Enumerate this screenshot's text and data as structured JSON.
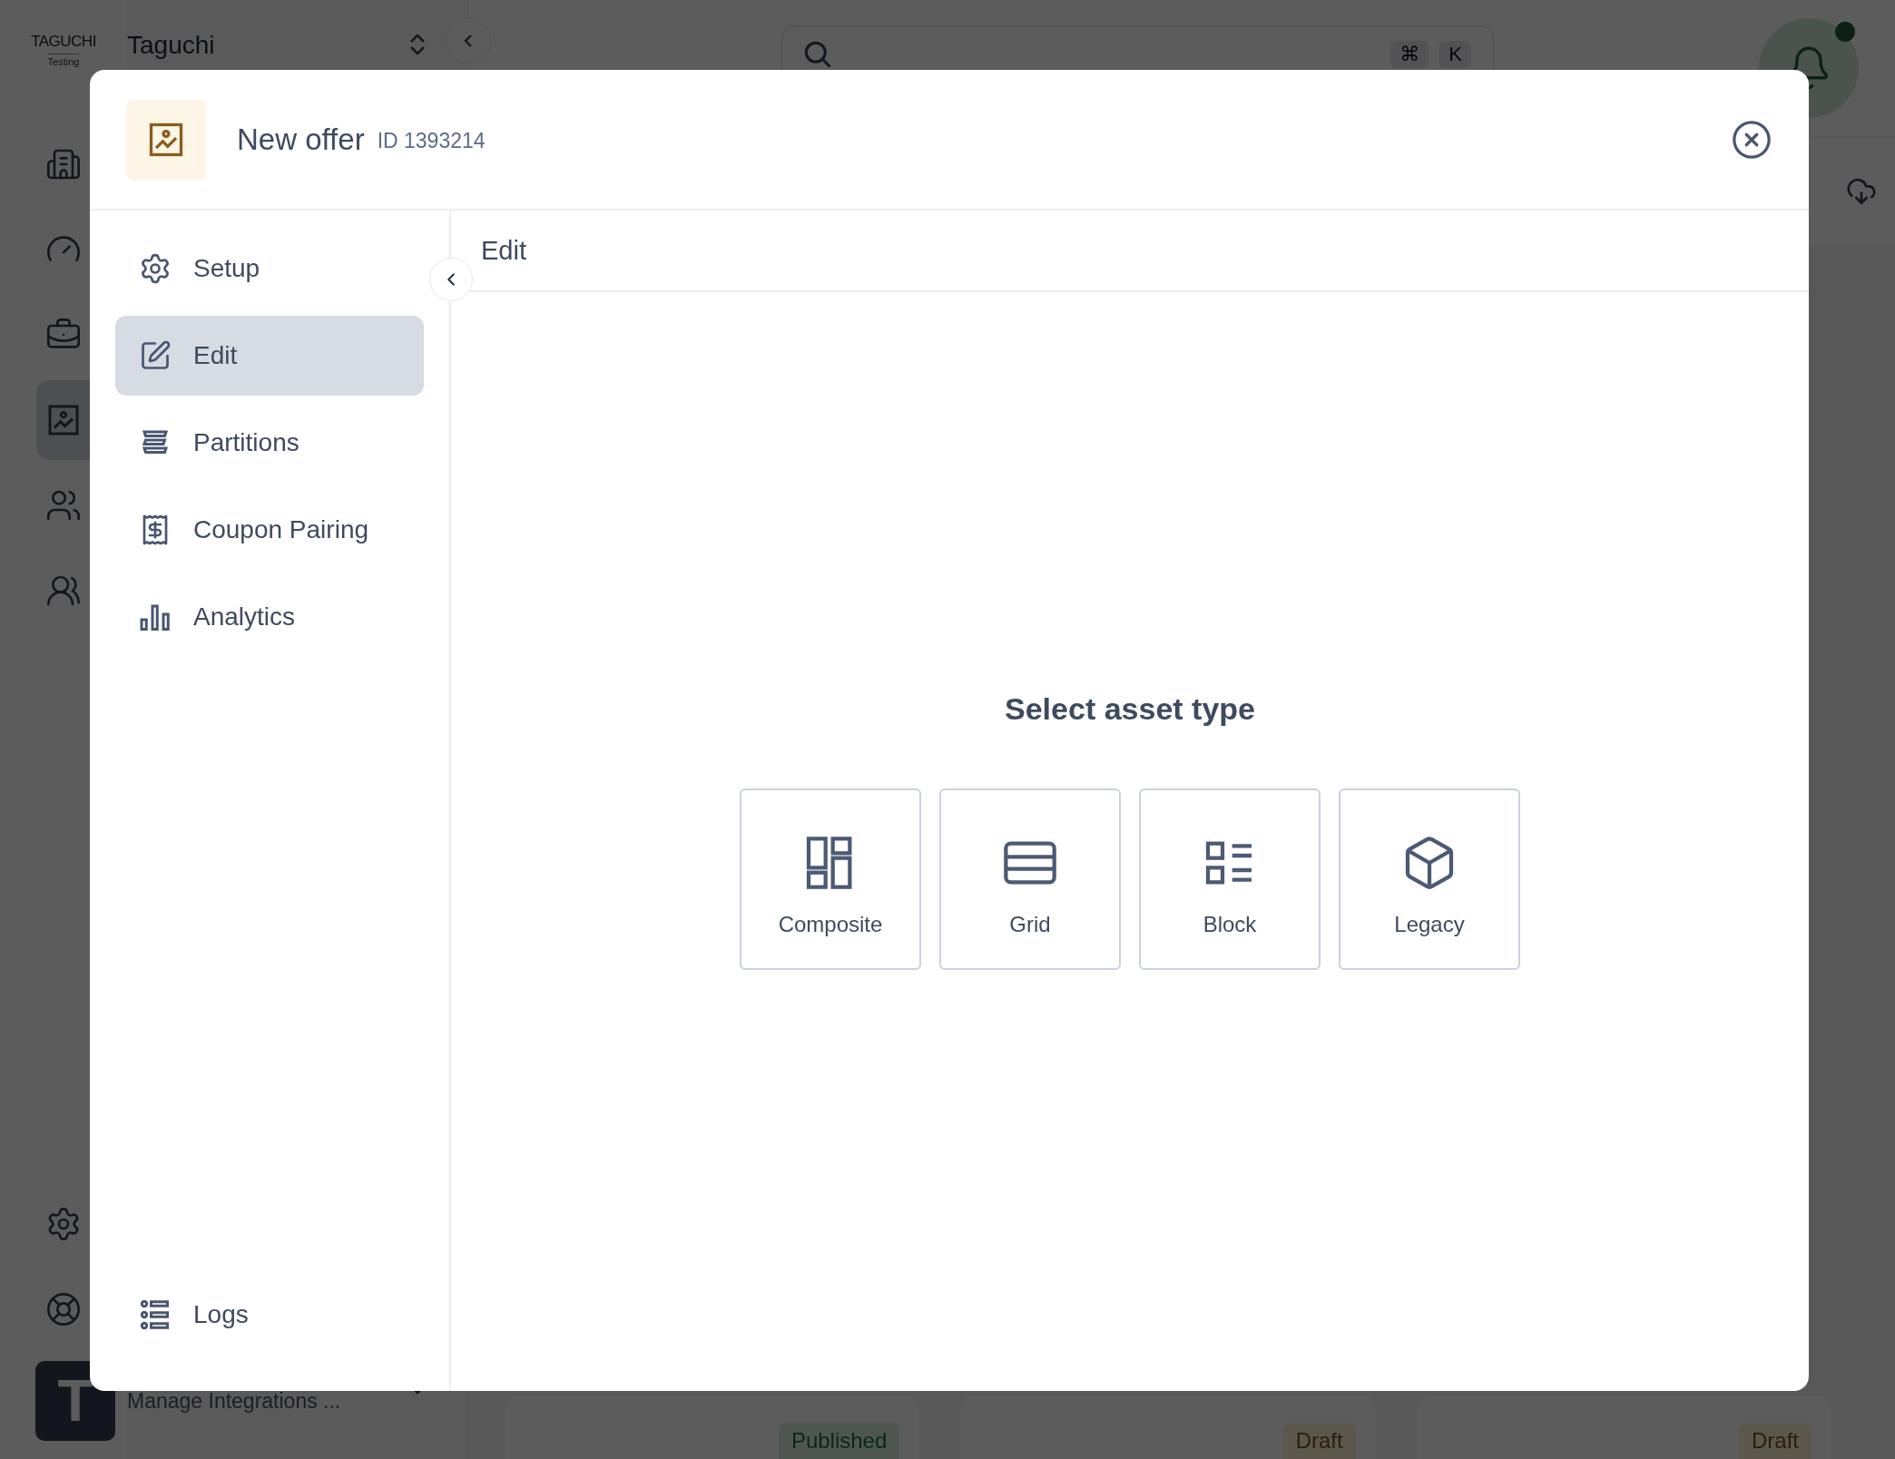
{
  "app": {
    "logo": {
      "brand": "TAGUCHI",
      "subtitle": "Testing"
    },
    "account": {
      "name": "Taguchi"
    },
    "rail_items": [
      {
        "kind": "building",
        "selected": false
      },
      {
        "kind": "gauge",
        "selected": false
      },
      {
        "kind": "briefcase",
        "selected": false
      },
      {
        "kind": "image",
        "selected": true
      },
      {
        "kind": "users",
        "selected": false
      },
      {
        "kind": "team",
        "selected": false
      }
    ],
    "rail_footer": [
      {
        "kind": "settings",
        "selected": false
      },
      {
        "kind": "lifebuoy",
        "selected": false
      }
    ],
    "user": {
      "initial": "T",
      "subtitle": "Manage Integrations ..."
    }
  },
  "page": {
    "search": {
      "keys": [
        "⌘",
        "K"
      ]
    },
    "notifications": {
      "unread": true
    },
    "cards": [
      {
        "status": "Published",
        "kind": "published"
      },
      {
        "status": "Draft",
        "kind": "draft"
      },
      {
        "status": "Draft",
        "kind": "draft"
      }
    ]
  },
  "modal": {
    "title": "New offer",
    "id": "ID 1393214",
    "nav": [
      {
        "label": "Setup",
        "kind": "setup",
        "selected": false
      },
      {
        "label": "Edit",
        "kind": "edit",
        "selected": true
      },
      {
        "label": "Partitions",
        "kind": "partitions",
        "selected": false
      },
      {
        "label": "Coupon Pairing",
        "kind": "coupon",
        "selected": false
      },
      {
        "label": "Analytics",
        "kind": "analytics",
        "selected": false
      }
    ],
    "footer_nav": [
      {
        "label": "Logs",
        "kind": "logs",
        "selected": false
      }
    ],
    "section_title": "Edit",
    "prompt": "Select asset type",
    "asset_types": [
      {
        "label": "Composite",
        "kind": "composite"
      },
      {
        "label": "Grid",
        "kind": "grid"
      },
      {
        "label": "Block",
        "kind": "block"
      },
      {
        "label": "Legacy",
        "kind": "legacy"
      }
    ]
  }
}
